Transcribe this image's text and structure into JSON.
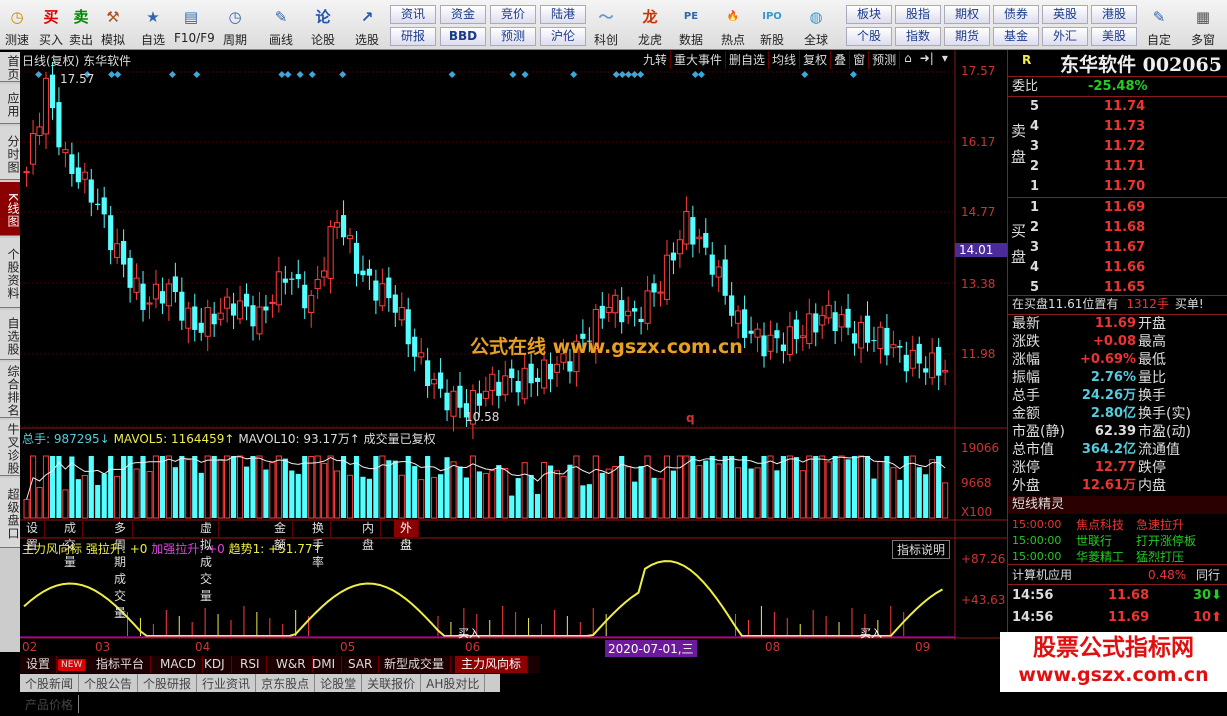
{
  "toolbar": {
    "items": [
      "测速",
      "买入",
      "卖出",
      "模拟",
      "自选",
      "F10/F9",
      "周期",
      "画线",
      "论股",
      "选股",
      "科创",
      "龙虎",
      "数据",
      "热点",
      "新股",
      "全球",
      "自定",
      "多窗"
    ],
    "small_top": [
      "资讯",
      "资金",
      "竞价",
      "陆港",
      "板块",
      "股指",
      "期权",
      "债券",
      "英股",
      "港股"
    ],
    "small_bottom": [
      "研报",
      "BBD",
      "预测",
      "沪伦",
      "个股",
      "指数",
      "期货",
      "基金",
      "外汇",
      "美股"
    ]
  },
  "sidebar": [
    "首页",
    "应用",
    "分时图",
    "K线图",
    "个股资料",
    "自选股",
    "综合排名",
    "牛叉诊股",
    "超级盘口"
  ],
  "chart": {
    "title": "日线(复权) 东华软件",
    "tools": [
      "九转",
      "重大事件",
      "删自选",
      "均线",
      "复权",
      "叠",
      "窗",
      "预测"
    ],
    "high_label": "17.57",
    "low_label": "10.58",
    "marker": "q",
    "price_axis": [
      "17.57",
      "16.17",
      "14.77",
      "13.38",
      "11.98"
    ],
    "current_price_tag": "14.01",
    "watermark": "公式在线  www.gszx.com.cn",
    "volume_header": {
      "total": "总手: 987295↓",
      "mavol5": "MAVOL5: 1164459↑",
      "mavol10": "MAVOL10: 93.17万↑",
      "note": "成交量已复权"
    },
    "volume_axis": [
      "19066",
      "9668",
      "X100"
    ],
    "volume_tabs": [
      "设置",
      "成交量",
      "多周期成交量",
      "虚拟成交量",
      "金额",
      "换手率",
      "内盘",
      "外盘"
    ],
    "indicator_header": {
      "name": "主力风向标",
      "a": "强拉升: +0",
      "b": "加强拉升: +0",
      "c": "趋势1: +51.77↑"
    },
    "indicator_button": "指标说明",
    "indicator_axis": [
      "+87.26",
      "+43.63"
    ],
    "buy_labels": [
      "买入",
      "买入"
    ],
    "date_axis": [
      "02",
      "03",
      "04",
      "05",
      "06",
      "2020-07-01,三",
      "08",
      "09"
    ],
    "bottom_tabs": [
      "设置",
      "NEW",
      "指标平台",
      "MACD",
      "KDJ",
      "RSI",
      "W&R",
      "DMI",
      "SAR",
      "新型成交量",
      "主力风向标"
    ]
  },
  "chart_data": {
    "type": "candlestick",
    "price_keypoints": [
      [
        0,
        15.6
      ],
      [
        3,
        17.3
      ],
      [
        6,
        15.8
      ],
      [
        10,
        15.2
      ],
      [
        14,
        14.0
      ],
      [
        18,
        13.0
      ],
      [
        22,
        13.3
      ],
      [
        26,
        12.5
      ],
      [
        32,
        13.0
      ],
      [
        36,
        12.7
      ],
      [
        40,
        13.6
      ],
      [
        44,
        13.0
      ],
      [
        48,
        14.7
      ],
      [
        52,
        13.5
      ],
      [
        57,
        13.0
      ],
      [
        60,
        12.0
      ],
      [
        64,
        11.2
      ],
      [
        68,
        10.9
      ],
      [
        72,
        11.4
      ],
      [
        78,
        11.5
      ],
      [
        84,
        11.9
      ],
      [
        90,
        13.0
      ],
      [
        94,
        12.7
      ],
      [
        98,
        13.4
      ],
      [
        102,
        14.6
      ],
      [
        106,
        13.8
      ],
      [
        110,
        12.6
      ],
      [
        114,
        12.2
      ],
      [
        118,
        12.3
      ],
      [
        124,
        12.8
      ],
      [
        128,
        12.4
      ],
      [
        132,
        12.3
      ],
      [
        136,
        11.9
      ],
      [
        142,
        11.7
      ]
    ]
  },
  "quote": {
    "name": "东华软件 002065",
    "r": "R",
    "weibi_label": "委比",
    "weibi": "-25.48%",
    "sell_label": "卖盘",
    "buy_label": "买盘",
    "sell": [
      [
        "5",
        "11.74"
      ],
      [
        "4",
        "11.73"
      ],
      [
        "3",
        "11.72"
      ],
      [
        "2",
        "11.71"
      ],
      [
        "1",
        "11.70"
      ]
    ],
    "buy": [
      [
        "1",
        "11.69"
      ],
      [
        "2",
        "11.68"
      ],
      [
        "3",
        "11.67"
      ],
      [
        "4",
        "11.66"
      ],
      [
        "5",
        "11.65"
      ]
    ],
    "notice": "在买盘11.61位置有",
    "notice_qty": "1312手",
    "notice_end": "买单!",
    "stats": [
      [
        "最新",
        "11.69",
        "开盘",
        "red"
      ],
      [
        "涨跌",
        "+0.08",
        "最高",
        "red"
      ],
      [
        "涨幅",
        "+0.69%",
        "最低",
        "red"
      ],
      [
        "振幅",
        "2.76%",
        "量比",
        "cyan"
      ],
      [
        "总手",
        "24.26万",
        "换手",
        "cyan"
      ],
      [
        "金额",
        "2.80亿",
        "换手(实)",
        "cyan"
      ],
      [
        "市盈(静)",
        "62.39",
        "市盈(动)",
        "wht"
      ],
      [
        "总市值",
        "364.2亿",
        "流通值",
        "cyan"
      ],
      [
        "涨停",
        "12.77",
        "跌停",
        "red"
      ],
      [
        "外盘",
        "12.61万",
        "内盘",
        "red"
      ]
    ],
    "sprite_title": "短线精灵",
    "sprite": [
      [
        "15:00:00",
        "焦点科技",
        "急速拉升",
        "red"
      ],
      [
        "15:00:00",
        "世联行",
        "打开涨停板",
        "grn"
      ],
      [
        "15:00:00",
        "华菱精工",
        "猛烈打压",
        "grn"
      ]
    ],
    "sector": "计算机应用",
    "sector_pct": "0.48%",
    "sector_more": "同行",
    "ticks": [
      [
        "14:56",
        "11.68",
        "30",
        "grn"
      ],
      [
        "14:56",
        "11.69",
        "10",
        "red"
      ]
    ]
  },
  "logo": {
    "title": "股票公式指标网",
    "url": "www.gszx.com.cn"
  },
  "bottom_grey": [
    "个股新闻",
    "个股公告",
    "个股研报",
    "行业资讯",
    "京东股点",
    "论股堂",
    "关联报价",
    "AH股对比",
    "产品价格"
  ]
}
